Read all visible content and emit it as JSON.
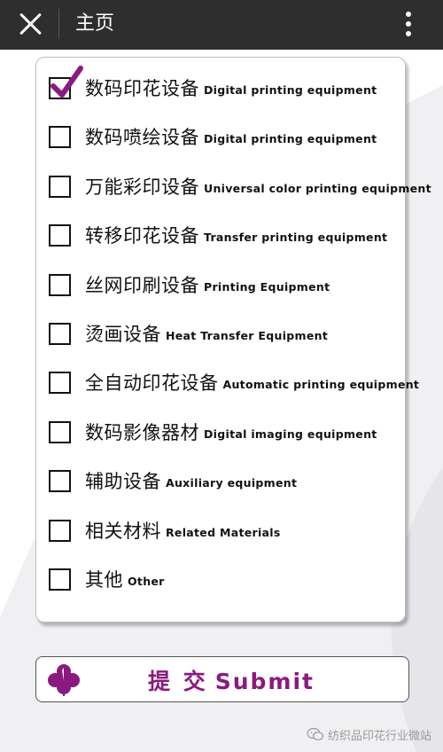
{
  "header": {
    "title": "主页",
    "close_icon": "close-icon",
    "more_icon": "more-vertical-icon",
    "background": "#2e2e2e"
  },
  "form": {
    "options": [
      {
        "zh": "数码印花设备",
        "en": "Digital printing equipment",
        "checked": true
      },
      {
        "zh": "数码喷绘设备",
        "en": "Digital printing equipment",
        "checked": false
      },
      {
        "zh": "万能彩印设备",
        "en": "Universal color printing equipment",
        "checked": false
      },
      {
        "zh": "转移印花设备",
        "en": "Transfer printing equipment",
        "checked": false
      },
      {
        "zh": "丝网印刷设备",
        "en": "Printing Equipment",
        "checked": false
      },
      {
        "zh": "烫画设备",
        "en": "Heat Transfer Equipment",
        "checked": false
      },
      {
        "zh": "全自动印花设备",
        "en": "Automatic printing equipment",
        "checked": false
      },
      {
        "zh": "数码影像器材",
        "en": "Digital imaging equipment",
        "checked": false
      },
      {
        "zh": "辅助设备",
        "en": "Auxiliary equipment",
        "checked": false
      },
      {
        "zh": "相关材料",
        "en": "Related Materials",
        "checked": false
      },
      {
        "zh": "其他",
        "en": "Other",
        "checked": false
      }
    ],
    "check_color": "#8b1a7e"
  },
  "submit": {
    "label_zh": "提 交",
    "label_en": "Submit",
    "icon": "clover-icon",
    "color": "#8b1a7e"
  },
  "watermark": {
    "text": "纺织品印花行业微站",
    "icon": "wechat-icon"
  }
}
